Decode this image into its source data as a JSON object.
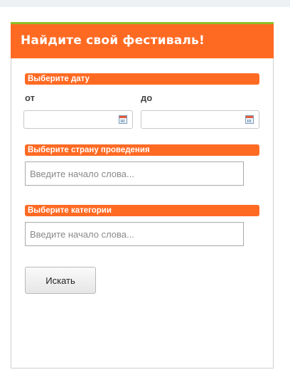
{
  "header": {
    "title": "Найдите свой фестиваль!"
  },
  "date_section": {
    "label": "Выберите дату",
    "from_label": "от",
    "to_label": "до"
  },
  "country_section": {
    "label": "Выберите страну проведения",
    "placeholder": "Введите начало слова..."
  },
  "category_section": {
    "label": "Выберите категории",
    "placeholder": "Введите начало слова..."
  },
  "actions": {
    "search_label": "Искать"
  },
  "colors": {
    "accent": "#ff6a23",
    "header_top_border": "#8cbf26"
  },
  "icons": {
    "date_picker": "calendar-icon"
  }
}
